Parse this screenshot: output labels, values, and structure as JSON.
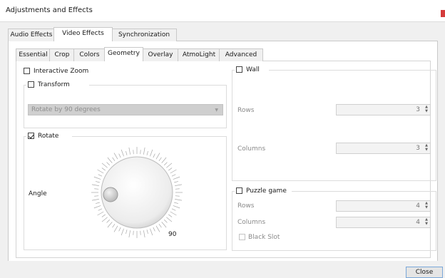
{
  "window": {
    "title": "Adjustments and Effects",
    "close_color": "#d43b3b"
  },
  "main_tabs": [
    {
      "label": "Audio Effects",
      "active": false
    },
    {
      "label": "Video Effects",
      "active": true
    },
    {
      "label": "Synchronization",
      "active": false
    }
  ],
  "sub_tabs": [
    {
      "label": "Essential",
      "active": false
    },
    {
      "label": "Crop",
      "active": false
    },
    {
      "label": "Colors",
      "active": false
    },
    {
      "label": "Geometry",
      "active": true
    },
    {
      "label": "Overlay",
      "active": false
    },
    {
      "label": "AtmoLight",
      "active": false
    },
    {
      "label": "Advanced",
      "active": false
    }
  ],
  "geometry": {
    "interactive_zoom": {
      "label": "Interactive Zoom",
      "checked": false
    },
    "transform": {
      "label": "Transform",
      "checked": false,
      "combo_value": "Rotate by 90 degrees"
    },
    "rotate": {
      "label": "Rotate",
      "checked": true,
      "angle_label": "Angle",
      "angle_value": "90"
    },
    "wall": {
      "label": "Wall",
      "checked": false,
      "rows_label": "Rows",
      "rows_value": "3",
      "columns_label": "Columns",
      "columns_value": "3"
    },
    "puzzle": {
      "label": "Puzzle game",
      "checked": false,
      "rows_label": "Rows",
      "rows_value": "4",
      "columns_label": "Columns",
      "columns_value": "4",
      "black_slot_label": "Black Slot",
      "black_slot_checked": false
    }
  },
  "footer": {
    "close_label": "Close"
  }
}
